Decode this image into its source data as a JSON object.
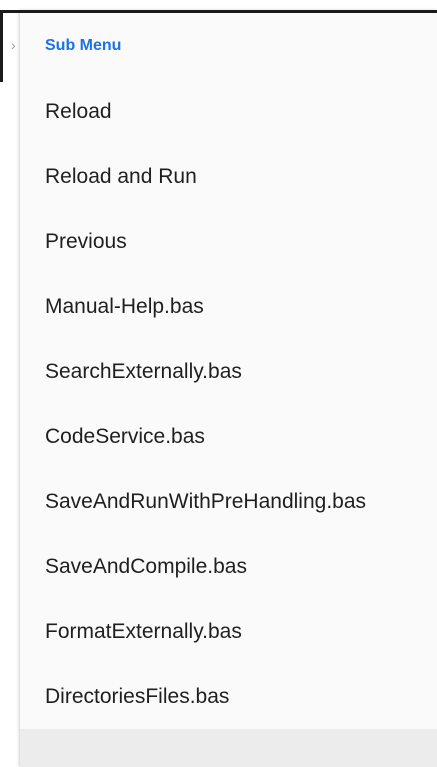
{
  "submenu": {
    "header": "Sub Menu",
    "items": [
      {
        "label": "Reload"
      },
      {
        "label": "Reload and Run"
      },
      {
        "label": "Previous"
      },
      {
        "label": "Manual-Help.bas"
      },
      {
        "label": "SearchExternally.bas"
      },
      {
        "label": "CodeService.bas"
      },
      {
        "label": "SaveAndRunWithPreHandling.bas"
      },
      {
        "label": "SaveAndCompile.bas"
      },
      {
        "label": "FormatExternally.bas"
      },
      {
        "label": "DirectoriesFiles.bas"
      }
    ]
  },
  "colors": {
    "header_text": "#1a73e8",
    "item_text": "#1f1f1f",
    "menu_background": "#fafafa",
    "footer_background": "#ececec"
  }
}
